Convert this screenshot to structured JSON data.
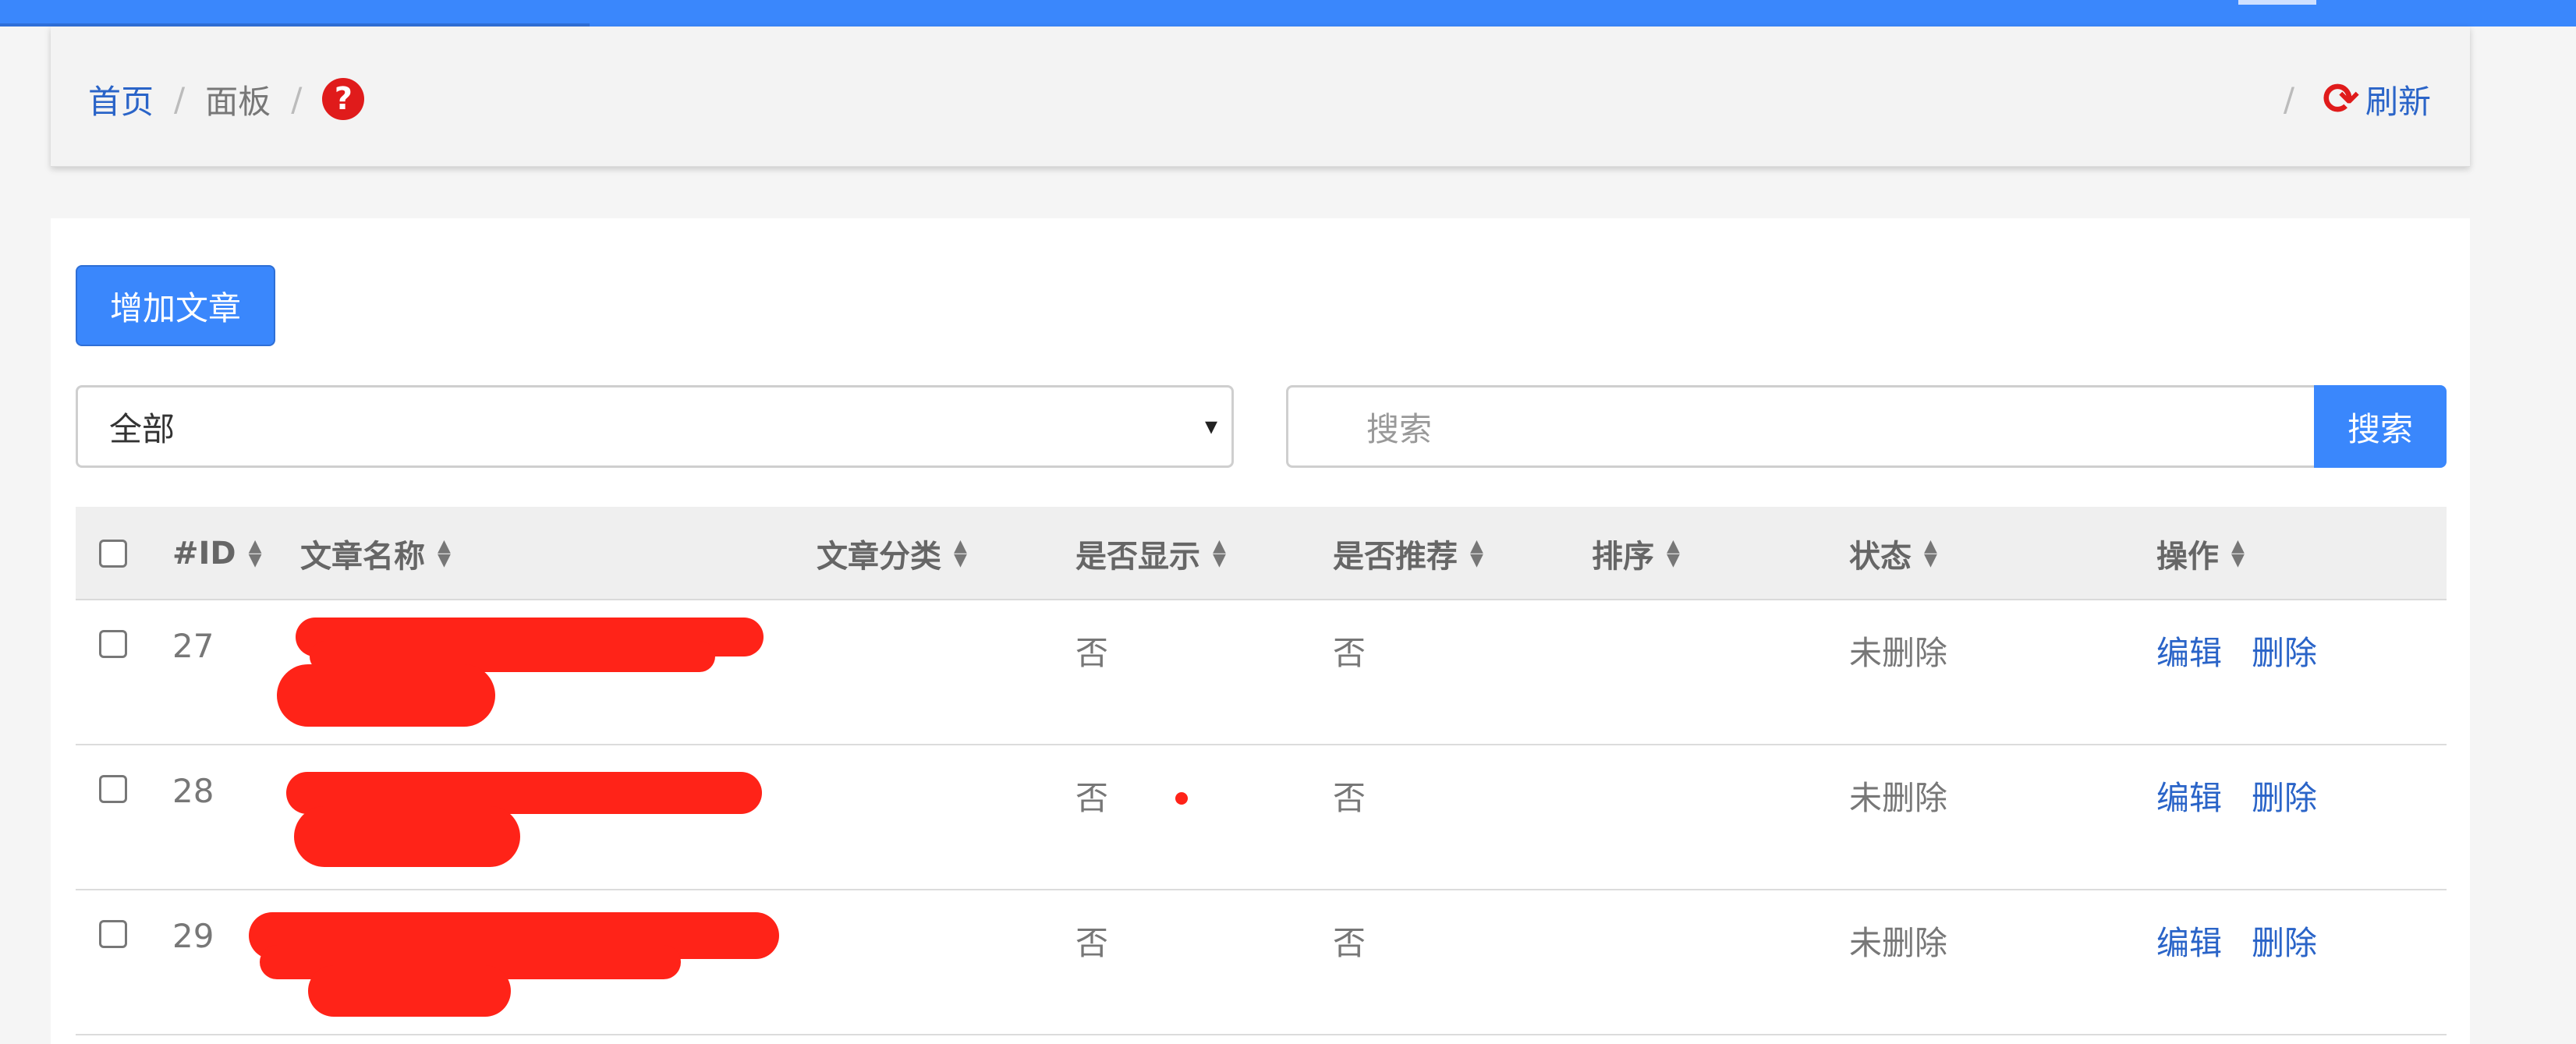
{
  "breadcrumb": {
    "home": "首页",
    "sep": "/",
    "panel": "面板",
    "help_glyph": "?"
  },
  "header_actions": {
    "refresh_label": "刷新",
    "refresh_glyph": "⟳"
  },
  "toolbar": {
    "add_label": "增加文章"
  },
  "filter": {
    "selected": "全部",
    "caret": "▾"
  },
  "search": {
    "placeholder": "搜索",
    "button_label": "搜索"
  },
  "table": {
    "headers": [
      "#ID",
      "文章名称",
      "文章分类",
      "是否显示",
      "是否推荐",
      "排序",
      "状态",
      "操作"
    ],
    "rows": [
      {
        "id": "27",
        "show": "否",
        "recommend": "否",
        "status": "未删除",
        "edit": "编辑",
        "delete": "删除"
      },
      {
        "id": "28",
        "show": "否",
        "recommend": "否",
        "status": "未删除",
        "edit": "编辑",
        "delete": "删除"
      },
      {
        "id": "29",
        "show": "否",
        "recommend": "否",
        "status": "未删除",
        "edit": "编辑",
        "delete": "删除"
      }
    ]
  },
  "colors": {
    "accent": "#3a87fc",
    "link": "#2a64c8",
    "icon_red": "#e01b1b",
    "redaction": "#ff2318"
  }
}
